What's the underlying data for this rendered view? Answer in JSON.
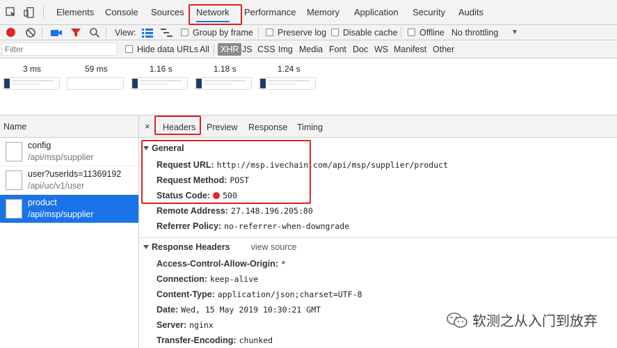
{
  "tabs": [
    "Elements",
    "Console",
    "Sources",
    "Network",
    "Performance",
    "Memory",
    "Application",
    "Security",
    "Audits"
  ],
  "active_tab": "Network",
  "toolbar": {
    "view_label": "View:",
    "group_by_frame": "Group by frame",
    "preserve_log": "Preserve log",
    "disable_cache": "Disable cache",
    "offline": "Offline",
    "throttling": "No throttling"
  },
  "filterbar": {
    "placeholder": "Filter",
    "hide_data_urls": "Hide data URLs",
    "types": [
      "All",
      "XHR",
      "JS",
      "CSS",
      "Img",
      "Media",
      "Font",
      "Doc",
      "WS",
      "Manifest",
      "Other"
    ],
    "active_type": "XHR"
  },
  "overview": {
    "times": [
      "3 ms",
      "59 ms",
      "1.16 s",
      "1.18 s",
      "1.24 s"
    ]
  },
  "requests": {
    "header": "Name",
    "items": [
      {
        "name": "config",
        "path": "/api/msp/supplier"
      },
      {
        "name": "user?userIds=11369192",
        "path": "/api/uc/v1/user"
      },
      {
        "name": "product",
        "path": "/api/msp/supplier"
      }
    ]
  },
  "detail": {
    "close": "×",
    "tabs": [
      "Headers",
      "Preview",
      "Response",
      "Timing"
    ],
    "general": {
      "title": "General",
      "request_url_k": "Request URL:",
      "request_url_v": "http://msp.ivechain.com/api/msp/supplier/product",
      "request_method_k": "Request Method:",
      "request_method_v": "POST",
      "status_code_k": "Status Code:",
      "status_code_v": "500",
      "remote_address_k": "Remote Address:",
      "remote_address_v": "27.148.196.205:80",
      "referrer_policy_k": "Referrer Policy:",
      "referrer_policy_v": "no-referrer-when-downgrade"
    },
    "response_headers": {
      "title": "Response Headers",
      "view_source": "view source",
      "items": [
        {
          "k": "Access-Control-Allow-Origin:",
          "v": "*"
        },
        {
          "k": "Connection:",
          "v": "keep-alive"
        },
        {
          "k": "Content-Type:",
          "v": "application/json;charset=UTF-8"
        },
        {
          "k": "Date:",
          "v": "Wed, 15 May 2019 10:30:21 GMT"
        },
        {
          "k": "Server:",
          "v": "nginx"
        },
        {
          "k": "Transfer-Encoding:",
          "v": "chunked"
        }
      ]
    }
  },
  "watermark": "软测之从入门到放弃",
  "colors": {
    "accent": "#1a73e8",
    "record": "#e0242a",
    "highlight_box": "#e02020"
  }
}
